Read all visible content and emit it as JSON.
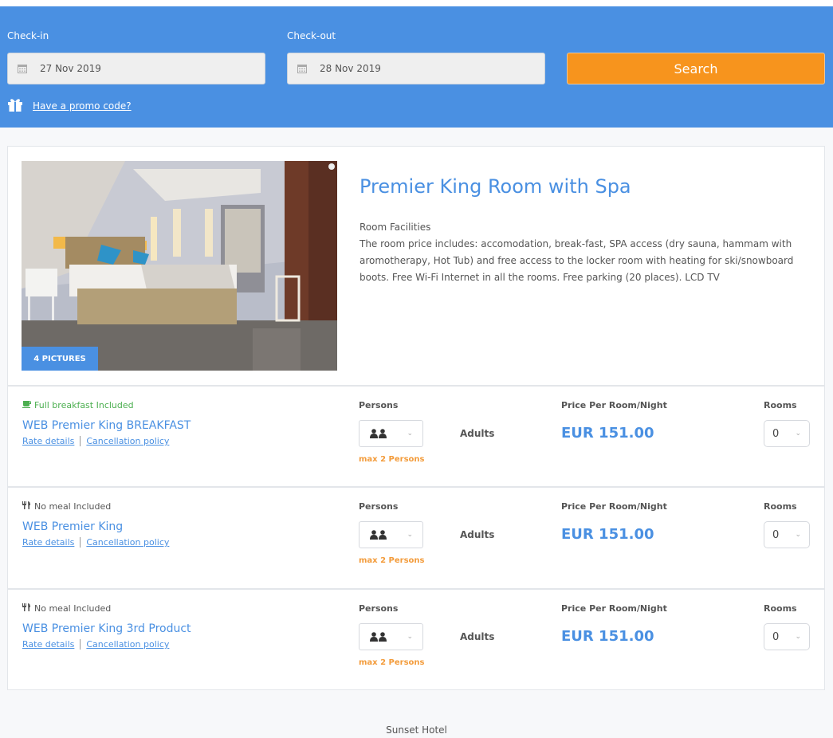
{
  "search": {
    "checkin_label": "Check-in",
    "checkin_value": "27 Nov 2019",
    "checkout_label": "Check-out",
    "checkout_value": "28 Nov 2019",
    "search_label": "Search",
    "promo_label": "Have a promo code?"
  },
  "room": {
    "title": "Premier King Room with Spa",
    "pictures_label": "4 PICTURES",
    "facilities_label": "Room Facilities",
    "facilities_text": "The room price includes: accomodation, break-fast, SPA access (dry sauna, hammam with aromotherapy, Hot Tub) and free access to the locker room with heating for ski/snowboard boots. Free Wi-Fi Internet in all the rooms. Free parking (20 places). LCD TV"
  },
  "colors": {
    "brand_blue": "#4a90e2",
    "search_orange": "#f7941d",
    "breakfast_green": "#4caf50",
    "max_persons_orange": "#f39c3c"
  },
  "rate_labels": {
    "persons": "Persons",
    "price": "Price Per Room/Night",
    "rooms": "Rooms",
    "adults": "Adults",
    "max_persons": "max 2 Persons",
    "rate_details": "Rate details",
    "cancellation": "Cancellation policy"
  },
  "rates": [
    {
      "meal": "Full breakfast Included",
      "meal_icon": "coffee-cup-icon",
      "name": "WEB Premier King BREAKFAST",
      "price": "EUR 151.00",
      "rooms": "0"
    },
    {
      "meal": "No meal Included",
      "meal_icon": "cutlery-icon",
      "name": "WEB Premier King",
      "price": "EUR 151.00",
      "rooms": "0"
    },
    {
      "meal": "No meal Included",
      "meal_icon": "cutlery-icon",
      "name": "WEB Premier King 3rd Product",
      "price": "EUR 151.00",
      "rooms": "0"
    }
  ],
  "footer": {
    "hotel_name": "Sunset Hotel"
  }
}
